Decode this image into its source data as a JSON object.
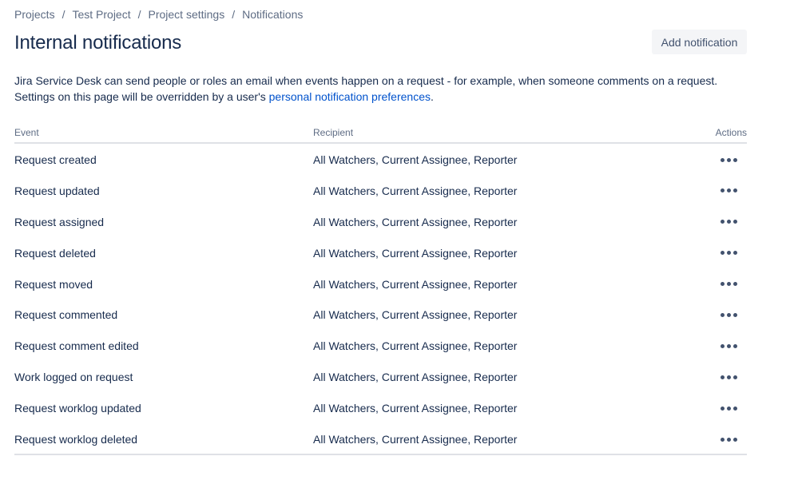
{
  "breadcrumbs": [
    {
      "label": "Projects"
    },
    {
      "label": "Test Project"
    },
    {
      "label": "Project settings"
    },
    {
      "label": "Notifications"
    }
  ],
  "breadcrumb_separator": "/",
  "page": {
    "title": "Internal notifications",
    "add_button_label": "Add notification",
    "description_text": "Jira Service Desk can send people or roles an email when events happen on a request - for example, when someone comments on a request. Settings on this page will be overridden by a user's ",
    "description_link": "personal notification preferences",
    "description_end": "."
  },
  "table": {
    "headers": {
      "event": "Event",
      "recipient": "Recipient",
      "actions": "Actions"
    },
    "rows": [
      {
        "event": "Request created",
        "recipient": "All Watchers, Current Assignee, Reporter"
      },
      {
        "event": "Request updated",
        "recipient": "All Watchers, Current Assignee, Reporter"
      },
      {
        "event": "Request assigned",
        "recipient": "All Watchers, Current Assignee, Reporter"
      },
      {
        "event": "Request deleted",
        "recipient": "All Watchers, Current Assignee, Reporter"
      },
      {
        "event": "Request moved",
        "recipient": "All Watchers, Current Assignee, Reporter"
      },
      {
        "event": "Request commented",
        "recipient": "All Watchers, Current Assignee, Reporter"
      },
      {
        "event": "Request comment edited",
        "recipient": "All Watchers, Current Assignee, Reporter"
      },
      {
        "event": "Work logged on request",
        "recipient": "All Watchers, Current Assignee, Reporter"
      },
      {
        "event": "Request worklog updated",
        "recipient": "All Watchers, Current Assignee, Reporter"
      },
      {
        "event": "Request worklog deleted",
        "recipient": "All Watchers, Current Assignee, Reporter"
      }
    ],
    "row_action_icon": "more-horizontal-icon"
  },
  "colors": {
    "text": "#172b4d",
    "muted": "#5e6c84",
    "link": "#0052cc",
    "button_bg": "#f4f5f7",
    "divider": "#dfe1e6"
  }
}
